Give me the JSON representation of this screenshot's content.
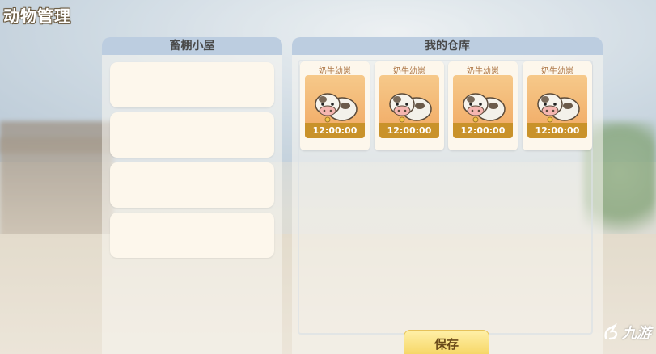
{
  "screen": {
    "title": "动物管理"
  },
  "barn": {
    "header": "畜棚小屋",
    "slots": [
      {
        "empty": true
      },
      {
        "empty": true
      },
      {
        "empty": true
      },
      {
        "empty": true
      }
    ]
  },
  "warehouse": {
    "header": "我的仓库",
    "items": [
      {
        "name": "奶牛幼崽",
        "timer": "12:00:00",
        "icon": "calf-icon"
      },
      {
        "name": "奶牛幼崽",
        "timer": "12:00:00",
        "icon": "calf-icon"
      },
      {
        "name": "奶牛幼崽",
        "timer": "12:00:00",
        "icon": "calf-icon"
      },
      {
        "name": "奶牛幼崽",
        "timer": "12:00:00",
        "icon": "calf-icon"
      }
    ]
  },
  "actions": {
    "save_label": "保存"
  },
  "watermark": {
    "text": "九游"
  },
  "colors": {
    "panel_header": "#bccde0",
    "card_bg": "#fdf7ec",
    "timer_bar": "#c9922a",
    "save_button": "#f6d768"
  }
}
